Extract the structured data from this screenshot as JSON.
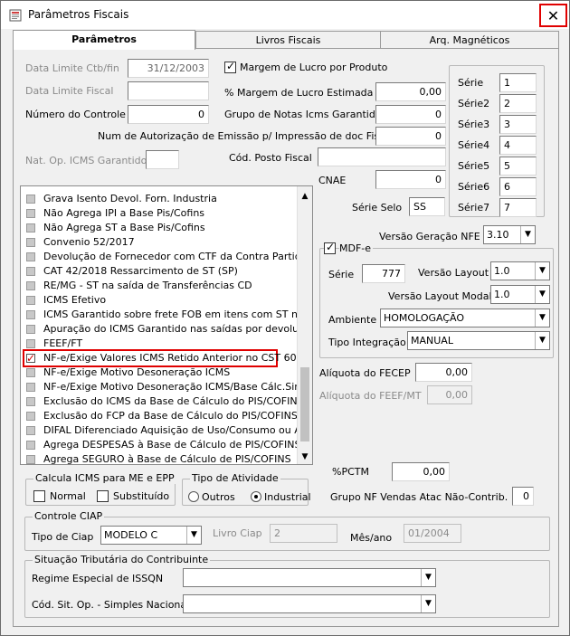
{
  "window": {
    "title": "Parâmetros Fiscais",
    "close": "✕"
  },
  "tabs": [
    "Parâmetros",
    "Livros Fiscais",
    "Arq. Magnéticos"
  ],
  "left_fields": {
    "data_limite_ctb_label": "Data Limite Ctb/fin",
    "data_limite_ctb_value": "31/12/2003",
    "data_limite_fiscal_label": "Data Limite Fiscal",
    "data_limite_fiscal_value": "",
    "numero_controle_label": "Número do Controle",
    "numero_controle_value": "0",
    "num_autorizacao_label": "Num de Autorização de Emissão p/ Impressão de doc Fiscais",
    "num_autorizacao_value": "0",
    "nat_op_label": "Nat. Op. ICMS Garantido",
    "nat_op_value": ""
  },
  "mid_fields": {
    "margem_lucro_produto_label": "Margem de Lucro por Produto",
    "margem_lucro_produto_checked": true,
    "margem_lucro_estimada_label": "% Margem de Lucro Estimada",
    "margem_lucro_estimada_value": "0,00",
    "grupo_notas_label": "Grupo de Notas Icms Garantido",
    "grupo_notas_value": "0",
    "cod_posto_label": "Cód. Posto Fiscal",
    "cod_posto_value": "",
    "cnae_label": "CNAE",
    "cnae_value": "0",
    "serie_selo_label": "Série Selo",
    "serie_selo_value": "SS"
  },
  "series": [
    {
      "label": "Série",
      "value": "1"
    },
    {
      "label": "Série2",
      "value": "2"
    },
    {
      "label": "Série3",
      "value": "3"
    },
    {
      "label": "Série4",
      "value": "4"
    },
    {
      "label": "Série5",
      "value": "5"
    },
    {
      "label": "Série6",
      "value": "6"
    },
    {
      "label": "Série7",
      "value": "7"
    }
  ],
  "options_list": [
    {
      "label": "Grava Isento Devol. Forn. Industria",
      "checked": false
    },
    {
      "label": "Não Agrega IPI a Base Pis/Cofins",
      "checked": false
    },
    {
      "label": "Não Agrega ST a Base Pis/Cofins",
      "checked": false
    },
    {
      "label": "Convenio 52/2017",
      "checked": false
    },
    {
      "label": "Devolução de Fornecedor com CTF da Contra Partida",
      "checked": false
    },
    {
      "label": "CAT 42/2018 Ressarcimento de ST (SP)",
      "checked": false
    },
    {
      "label": "RE/MG - ST na saída de Transferências CD",
      "checked": false
    },
    {
      "label": "ICMS Efetivo",
      "checked": false
    },
    {
      "label": "ICMS Garantido sobre frete FOB em itens com ST normal",
      "checked": false
    },
    {
      "label": "Apuração do ICMS Garantido nas saídas por devoluções",
      "checked": false
    },
    {
      "label": "FEEF/FT",
      "checked": false
    },
    {
      "label": "NF-e/Exige Valores ICMS Retido Anterior no CST 60",
      "checked": true
    },
    {
      "label": "NF-e/Exige Motivo Desoneração ICMS",
      "checked": false
    },
    {
      "label": "NF-e/Exige Motivo Desoneração ICMS/Base Cálc.Simples",
      "checked": false
    },
    {
      "label": "Exclusão do ICMS da Base de Cálculo do PIS/COFINS",
      "checked": false
    },
    {
      "label": "Exclusão do FCP da Base de Cálculo do PIS/COFINS",
      "checked": false
    },
    {
      "label": "DIFAL Diferenciado Aquisição de Uso/Consumo ou Ativo",
      "checked": false
    },
    {
      "label": "Agrega DESPESAS à Base de Cálculo de PIS/COFINS",
      "checked": false
    },
    {
      "label": "Agrega SEGURO à Base de Cálculo de PIS/COFINS",
      "checked": false
    }
  ],
  "nfe": {
    "versao_geracao_label": "Versão Geração NFE",
    "versao_geracao_value": "3.10",
    "mdfe_label": "MDF-e",
    "mdfe_checked": true,
    "serie_label": "Série",
    "serie_value": "777",
    "versao_layout_label": "Versão Layout",
    "versao_layout_value": "1.0",
    "versao_layout_modal_label": "Versão Layout Modal",
    "versao_layout_modal_value": "1.0",
    "ambiente_label": "Ambiente",
    "ambiente_value": "HOMOLOGAÇÃO",
    "tipo_integracao_label": "Tipo Integração",
    "tipo_integracao_value": "MANUAL"
  },
  "fecep": {
    "aliquota_fecep_label": "Alíquota do FECEP",
    "aliquota_fecep_value": "0,00",
    "aliquota_feef_label": "Alíquota do FEEF/MT",
    "aliquota_feef_value": "0,00",
    "pctm_label": "%PCTM",
    "pctm_value": "0,00",
    "grupo_nf_label": "Grupo NF Vendas Atac Não-Contrib.",
    "grupo_nf_value": "0"
  },
  "calc_icms": {
    "title": "Calcula ICMS para ME e EPP",
    "normal_label": "Normal",
    "substituido_label": "Substituído"
  },
  "tipo_atividade": {
    "title": "Tipo de Atividade",
    "outros_label": "Outros",
    "industrial_label": "Industrial",
    "selected": "Industrial"
  },
  "controle_ciap": {
    "title": "Controle CIAP",
    "tipo_ciap_label": "Tipo de Ciap",
    "tipo_ciap_value": "MODELO C",
    "livro_ciap_label": "Livro Ciap",
    "livro_ciap_value": "2",
    "mes_ano_label": "Mês/ano",
    "mes_ano_value": "01/2004"
  },
  "situacao": {
    "title": "Situação Tributária do Contribuinte",
    "regime_label": "Regime Especial de ISSQN",
    "regime_value": "",
    "cod_sit_label": "Cód. Sit. Op. - Simples Nacional",
    "cod_sit_value": ""
  }
}
